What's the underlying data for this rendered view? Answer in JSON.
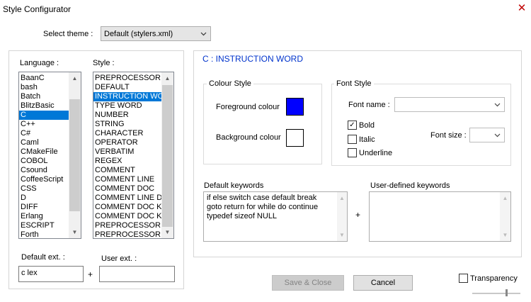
{
  "window": {
    "title": "Style Configurator",
    "close_glyph": "✕"
  },
  "theme": {
    "label": "Select theme :",
    "value": "Default (stylers.xml)"
  },
  "language": {
    "label": "Language :",
    "items": [
      "BaanC",
      "bash",
      "Batch",
      "BlitzBasic",
      "C",
      "C++",
      "C#",
      "Caml",
      "CMakeFile",
      "COBOL",
      "Csound",
      "CoffeeScript",
      "CSS",
      "D",
      "DIFF",
      "Erlang",
      "ESCRIPT",
      "Forth"
    ],
    "selected_index": 4
  },
  "style": {
    "label": "Style :",
    "items": [
      "PREPROCESSOR",
      "DEFAULT",
      "INSTRUCTION WORD",
      "TYPE WORD",
      "NUMBER",
      "STRING",
      "CHARACTER",
      "OPERATOR",
      "VERBATIM",
      "REGEX",
      "COMMENT",
      "COMMENT LINE",
      "COMMENT DOC",
      "COMMENT LINE DOC",
      "COMMENT DOC KEYWORD",
      "COMMENT DOC KEYWORD ERROR",
      "PREPROCESSOR COMMENT",
      "PREPROCESSOR COMMENT DOC"
    ],
    "selected_index": 2
  },
  "ext": {
    "default_label": "Default ext. :",
    "default_value": "c lex",
    "plus": "+",
    "user_label": "User ext. :",
    "user_value": ""
  },
  "panel": {
    "header": "C : INSTRUCTION WORD"
  },
  "colour_style": {
    "label": "Colour Style",
    "foreground_label": "Foreground colour",
    "background_label": "Background colour",
    "foreground_color": "#0000ff",
    "background_color": "#ffffff"
  },
  "font_style": {
    "label": "Font Style",
    "font_name_label": "Font name :",
    "font_name_value": "",
    "bold_label": "Bold",
    "bold_checked": "✓",
    "italic_label": "Italic",
    "underline_label": "Underline",
    "font_size_label": "Font size :",
    "font_size_value": ""
  },
  "keywords": {
    "default_label": "Default keywords",
    "default_lines": [
      "if else switch case default break",
      "goto return for while do continue",
      "typedef sizeof NULL"
    ],
    "plus": "+",
    "user_label": "User-defined keywords",
    "user_value": ""
  },
  "buttons": {
    "save_close": "Save & Close",
    "cancel": "Cancel"
  },
  "transparency": {
    "label": "Transparency"
  },
  "colors": {
    "selection": "#0078d7",
    "header_text": "#0033cc"
  }
}
